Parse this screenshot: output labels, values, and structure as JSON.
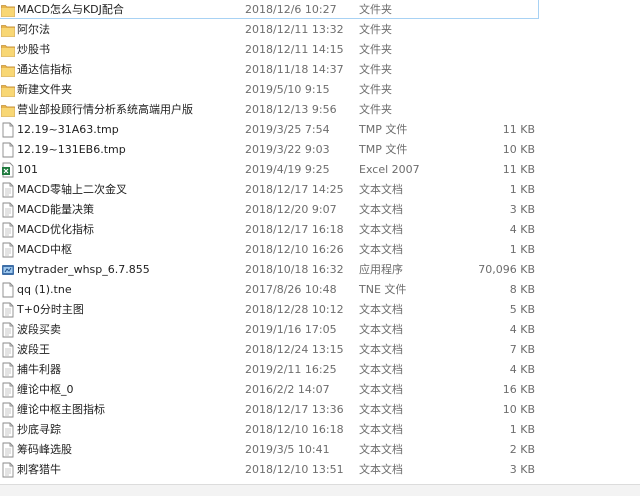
{
  "files": [
    {
      "name": "MACD怎么与KDJ配合",
      "date": "2018/12/6 10:27",
      "type": "文件夹",
      "size": "",
      "icon": "folder-icon",
      "selected": true
    },
    {
      "name": "阿尔法",
      "date": "2018/12/11 13:32",
      "type": "文件夹",
      "size": "",
      "icon": "folder-icon"
    },
    {
      "name": "炒股书",
      "date": "2018/12/11 14:15",
      "type": "文件夹",
      "size": "",
      "icon": "folder-icon"
    },
    {
      "name": "通达信指标",
      "date": "2018/11/18 14:37",
      "type": "文件夹",
      "size": "",
      "icon": "folder-icon"
    },
    {
      "name": "新建文件夹",
      "date": "2019/5/10 9:15",
      "type": "文件夹",
      "size": "",
      "icon": "folder-icon"
    },
    {
      "name": "营业部投顾行情分析系统高端用户版",
      "date": "2018/12/13 9:56",
      "type": "文件夹",
      "size": "",
      "icon": "folder-icon"
    },
    {
      "name": "12.19~31A63.tmp",
      "date": "2019/3/25 7:54",
      "type": "TMP 文件",
      "size": "11 KB",
      "icon": "file-icon"
    },
    {
      "name": "12.19~131EB6.tmp",
      "date": "2019/3/22 9:03",
      "type": "TMP 文件",
      "size": "10 KB",
      "icon": "file-icon"
    },
    {
      "name": "101",
      "date": "2019/4/19 9:25",
      "type": "Excel 2007",
      "size": "11 KB",
      "icon": "excel-icon"
    },
    {
      "name": "MACD零轴上二次金叉",
      "date": "2018/12/17 14:25",
      "type": "文本文档",
      "size": "1 KB",
      "icon": "text-file-icon"
    },
    {
      "name": "MACD能量决策",
      "date": "2018/12/20 9:07",
      "type": "文本文档",
      "size": "3 KB",
      "icon": "text-file-icon"
    },
    {
      "name": "MACD优化指标",
      "date": "2018/12/17 16:18",
      "type": "文本文档",
      "size": "4 KB",
      "icon": "text-file-icon"
    },
    {
      "name": "MACD中枢",
      "date": "2018/12/10 16:26",
      "type": "文本文档",
      "size": "1 KB",
      "icon": "text-file-icon"
    },
    {
      "name": "mytrader_whsp_6.7.855",
      "date": "2018/10/18 16:32",
      "type": "应用程序",
      "size": "70,096 KB",
      "icon": "app-icon"
    },
    {
      "name": "qq (1).tne",
      "date": "2017/8/26 10:48",
      "type": "TNE 文件",
      "size": "8 KB",
      "icon": "file-icon"
    },
    {
      "name": "T+0分时主图",
      "date": "2018/12/28 10:12",
      "type": "文本文档",
      "size": "5 KB",
      "icon": "text-file-icon"
    },
    {
      "name": "波段买卖",
      "date": "2019/1/16 17:05",
      "type": "文本文档",
      "size": "4 KB",
      "icon": "text-file-icon"
    },
    {
      "name": "波段王",
      "date": "2018/12/24 13:15",
      "type": "文本文档",
      "size": "7 KB",
      "icon": "text-file-icon"
    },
    {
      "name": "捕牛利器",
      "date": "2019/2/11 16:25",
      "type": "文本文档",
      "size": "4 KB",
      "icon": "text-file-icon"
    },
    {
      "name": "缠论中枢_0",
      "date": "2016/2/2 14:07",
      "type": "文本文档",
      "size": "16 KB",
      "icon": "text-file-icon"
    },
    {
      "name": "缠论中枢主图指标",
      "date": "2018/12/17 13:36",
      "type": "文本文档",
      "size": "10 KB",
      "icon": "text-file-icon"
    },
    {
      "name": "抄底寻踪",
      "date": "2018/12/10 16:18",
      "type": "文本文档",
      "size": "1 KB",
      "icon": "text-file-icon"
    },
    {
      "name": "筹码峰选股",
      "date": "2019/3/5 10:41",
      "type": "文本文档",
      "size": "2 KB",
      "icon": "text-file-icon"
    },
    {
      "name": "刺客猎牛",
      "date": "2018/12/10 13:51",
      "type": "文本文档",
      "size": "3 KB",
      "icon": "text-file-icon"
    }
  ]
}
